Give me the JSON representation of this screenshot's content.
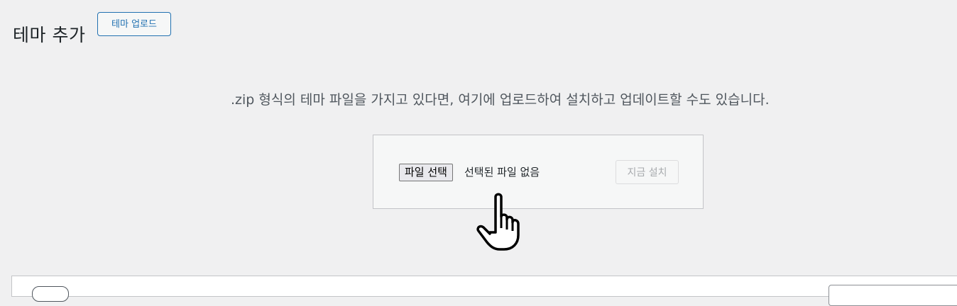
{
  "header": {
    "title": "테마 추가",
    "upload_button": "테마 업로드"
  },
  "upload": {
    "help_text": ".zip 형식의 테마 파일을 가지고 있다면, 여기에 업로드하여 설치하고 업데이트할 수도 있습니다.",
    "file_button": "파일 선택",
    "file_status": "선택된 파일 없음",
    "install_button": "지금 설치"
  },
  "cursor": {
    "icon": "hand-pointer-icon"
  },
  "colors": {
    "accent": "#2271b1",
    "background": "#f0f0f1",
    "disabled_text": "#a7aaad"
  }
}
